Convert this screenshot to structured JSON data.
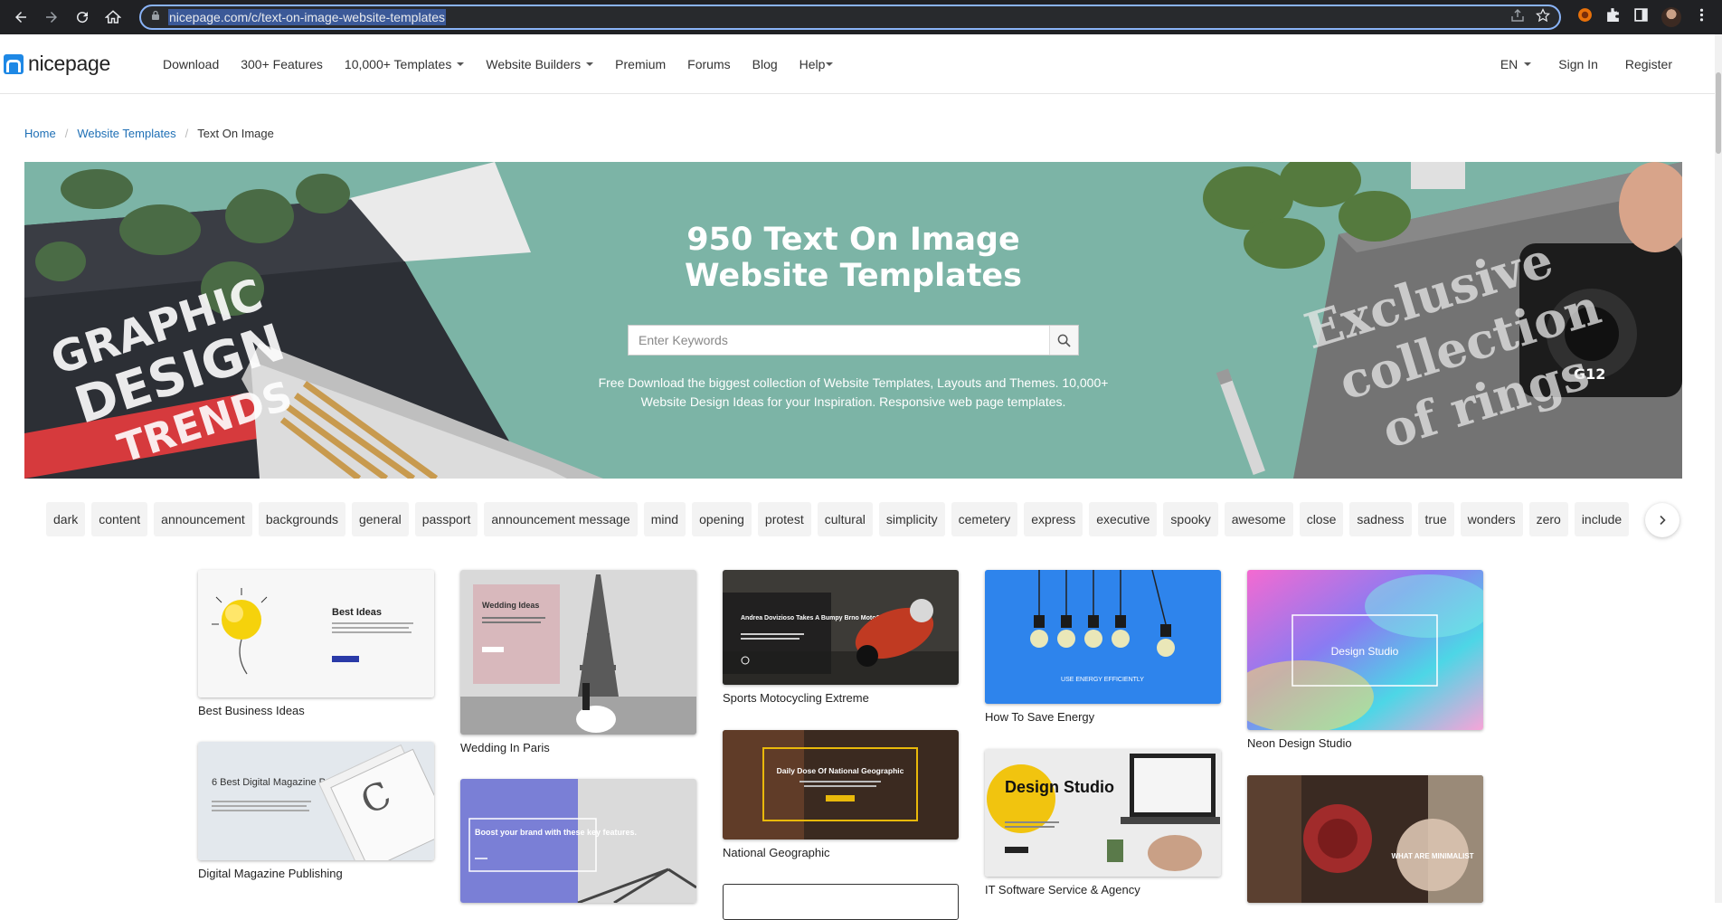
{
  "browser": {
    "url": "nicepage.com/c/text-on-image-website-templates"
  },
  "header": {
    "logo_text": "nicepage",
    "nav": [
      {
        "label": "Download",
        "dropdown": false
      },
      {
        "label": "300+ Features",
        "dropdown": false
      },
      {
        "label": "10,000+ Templates",
        "dropdown": true
      },
      {
        "label": "Website Builders",
        "dropdown": true
      },
      {
        "label": "Premium",
        "dropdown": false
      },
      {
        "label": "Forums",
        "dropdown": false
      },
      {
        "label": "Blog",
        "dropdown": false
      },
      {
        "label": "Help",
        "dropdown": true
      }
    ],
    "language": "EN",
    "sign_in": "Sign In",
    "register": "Register"
  },
  "breadcrumb": {
    "home": "Home",
    "website_templates": "Website Templates",
    "current": "Text On Image"
  },
  "hero": {
    "title": "950 Text On Image Website Templates",
    "search_placeholder": "Enter Keywords",
    "description": "Free Download the biggest collection of Website Templates, Layouts and Themes. 10,000+ Website Design Ideas for your Inspiration. Responsive web page templates.",
    "left_image_text": [
      "GRAPHIC",
      "DESIGN",
      "TRENDS"
    ],
    "right_image_text": [
      "Exclusive",
      "collection",
      "of rings"
    ],
    "camera_label": "G12"
  },
  "tags": [
    "dark",
    "content",
    "announcement",
    "backgrounds",
    "general",
    "passport",
    "announcement message",
    "mind",
    "opening",
    "protest",
    "cultural",
    "simplicity",
    "cemetery",
    "express",
    "executive",
    "spooky",
    "awesome",
    "close",
    "sadness",
    "true",
    "wonders",
    "zero",
    "include"
  ],
  "templates": {
    "col1": [
      {
        "title": "Best Business Ideas",
        "thumb_heading": "Best Ideas"
      },
      {
        "title": "Digital Magazine Publishing",
        "thumb_heading": "6 Best Digital Magazine Publishing"
      }
    ],
    "col2": [
      {
        "title": "Wedding In Paris",
        "thumb_heading": "Wedding Ideas"
      },
      {
        "title": "",
        "thumb_heading": "Boost your brand with these key features."
      }
    ],
    "col3": [
      {
        "title": "Sports Motocycling Extreme",
        "thumb_heading": "Andrea Dovizioso Takes A Bumpy Brno MotoGP"
      },
      {
        "title": "National Geographic",
        "thumb_heading": "Daily Dose Of National Geographic"
      }
    ],
    "col4": [
      {
        "title": "How To Save Energy",
        "thumb_heading": "USE ENERGY EFFICIENTLY"
      },
      {
        "title": "IT Software Service & Agency",
        "thumb_heading": "Design Studio"
      }
    ],
    "col5": [
      {
        "title": "Neon Design Studio",
        "thumb_heading": "Design Studio"
      },
      {
        "title": "",
        "thumb_heading": "WHAT ARE MINIMALIST"
      }
    ]
  },
  "colors": {
    "hero_bg": "#7cb4a6",
    "link": "#1e6fb5",
    "logo": "#1e88e5"
  }
}
